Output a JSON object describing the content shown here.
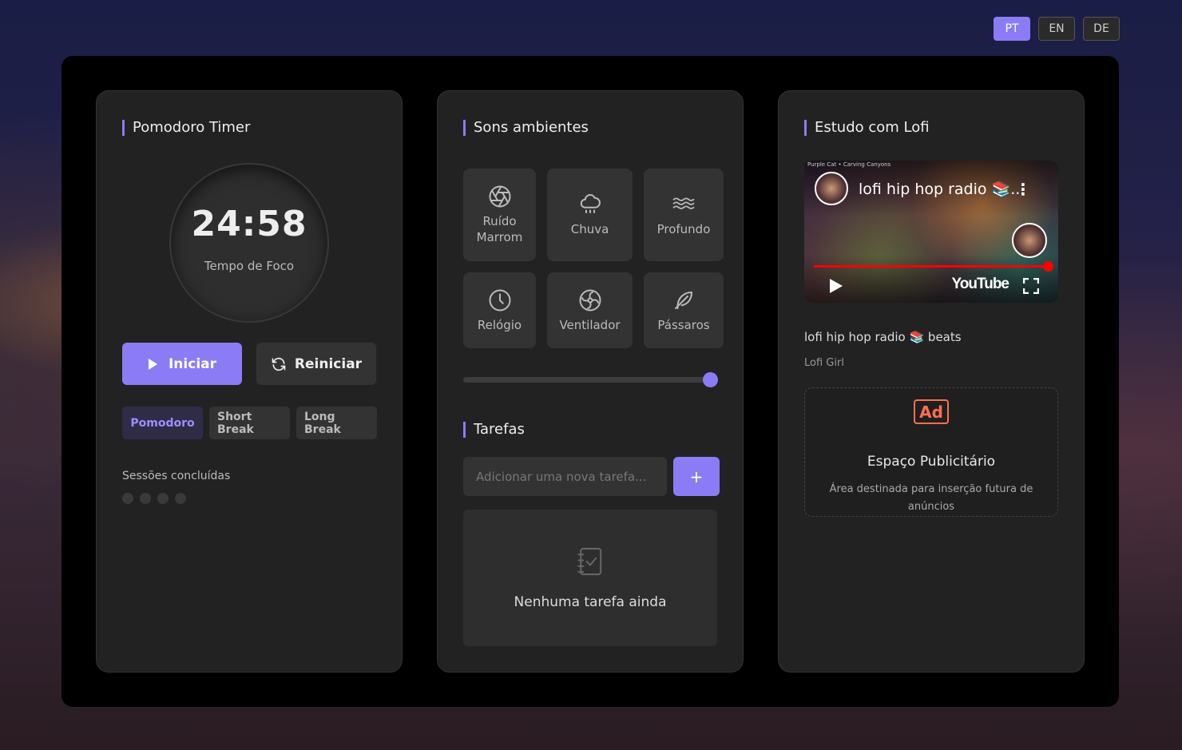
{
  "languages": [
    {
      "code": "PT",
      "active": true
    },
    {
      "code": "EN",
      "active": false
    },
    {
      "code": "DE",
      "active": false
    }
  ],
  "pomodoro": {
    "title": "Pomodoro Timer",
    "time": "24:58",
    "label": "Tempo de Foco",
    "start_label": "Iniciar",
    "reset_label": "Reiniciar",
    "modes": [
      "Pomodoro",
      "Short Break",
      "Long Break"
    ],
    "active_mode": "Pomodoro",
    "sessions_label": "Sessões concluídas",
    "sessions_completed": 0,
    "sessions_total": 4
  },
  "sounds": {
    "title": "Sons ambientes",
    "items": [
      {
        "label": "Ruído Marrom",
        "icon": "aperture-icon"
      },
      {
        "label": "Chuva",
        "icon": "cloud-rain-icon"
      },
      {
        "label": "Profundo",
        "icon": "waves-icon"
      },
      {
        "label": "Relógio",
        "icon": "clock-icon"
      },
      {
        "label": "Ventilador",
        "icon": "fan-icon"
      },
      {
        "label": "Pássaros",
        "icon": "feather-icon"
      }
    ],
    "volume": 1.0
  },
  "tasks": {
    "title": "Tarefas",
    "placeholder": "Adicionar uma nova tarefa...",
    "add_label": "+",
    "empty_text": "Nenhuma tarefa ainda"
  },
  "lofi": {
    "title": "Estudo com Lofi",
    "video_subtitle": "Purple Cat • Carving Canyons",
    "video_title": "lofi hip hop radio 📚...",
    "youtube_label": "YouTube",
    "meta_title": "lofi hip hop radio 📚 beats",
    "channel": "Lofi Girl"
  },
  "ad": {
    "icon_text": "Ad",
    "title": "Espaço Publicitário",
    "description": "Área destinada para inserção futura de anúncios"
  },
  "colors": {
    "accent": "#8b7cf6",
    "card": "#222222",
    "ad_accent": "#ff6f4e"
  }
}
